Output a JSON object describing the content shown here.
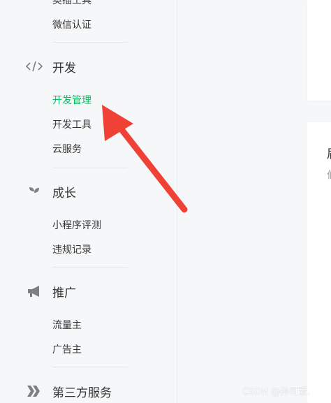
{
  "sidebar": {
    "partial_top_item": "奥插工具",
    "items_group1": [
      {
        "label": "微信认证"
      }
    ],
    "section_dev": {
      "label": "开发",
      "icon": "code-icon",
      "items": [
        {
          "label": "开发管理",
          "active": true
        },
        {
          "label": "开发工具",
          "active": false
        },
        {
          "label": "云服务",
          "active": false
        }
      ]
    },
    "section_growth": {
      "label": "成长",
      "icon": "sprout-icon",
      "items": [
        {
          "label": "小程序评测"
        },
        {
          "label": "违规记录"
        }
      ]
    },
    "section_promo": {
      "label": "推广",
      "icon": "megaphone-icon",
      "items": [
        {
          "label": "流量主"
        },
        {
          "label": "广告主"
        }
      ]
    },
    "section_third": {
      "label": "第三方服务",
      "icon": "third-party-icon"
    }
  },
  "content": {
    "card_title_partial": "届",
    "card_sub_partial": "伯"
  },
  "watermark": "CSDN @孙可爱.",
  "colors": {
    "active": "#07c160",
    "arrow": "#ef4136",
    "sidebar_bg": "#f6f7f8"
  }
}
